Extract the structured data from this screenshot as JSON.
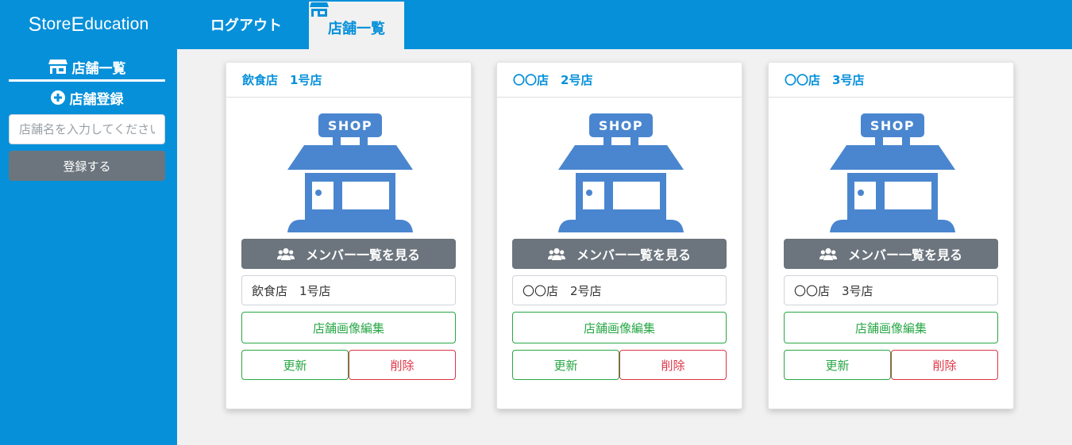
{
  "navbar": {
    "brand": {
      "first_cap": "S",
      "first_rest": "tore",
      "second_cap": "E",
      "second_rest": "ducation"
    },
    "logout_label": "ログアウト",
    "active_tab_label": "店舗一覧",
    "active_tab_icon": "store-icon"
  },
  "sidebar": {
    "title": "店舗一覧",
    "title_icon": "store-icon",
    "register_label": "店舗登録",
    "register_icon": "plus-circle-icon",
    "input_placeholder": "店舗名を入力してください",
    "submit_label": "登録する"
  },
  "cards": [
    {
      "title": "飲食店　1号店",
      "image": "shop-icon",
      "members_label": "メンバー一覧を見る",
      "members_icon": "users-icon",
      "name_value": "飲食店　1号店",
      "edit_image_label": "店舗画像編集",
      "update_label": "更新",
      "delete_label": "削除"
    },
    {
      "title": "〇〇店　2号店",
      "image": "shop-icon",
      "members_label": "メンバー一覧を見る",
      "members_icon": "users-icon",
      "name_value": "〇〇店　2号店",
      "edit_image_label": "店舗画像編集",
      "update_label": "更新",
      "delete_label": "削除"
    },
    {
      "title": "〇〇店　3号店",
      "image": "shop-icon",
      "members_label": "メンバー一覧を見る",
      "members_icon": "users-icon",
      "name_value": "〇〇店　3号店",
      "edit_image_label": "店舗画像編集",
      "update_label": "更新",
      "delete_label": "削除"
    }
  ],
  "shop_sign_text": "SHOP",
  "colors": {
    "primary": "#0690da",
    "background": "#f1f1f1",
    "secondary_button": "#6c757d",
    "success": "#28a745",
    "danger": "#dc3545",
    "shop_illustration": "#4a86cf"
  }
}
